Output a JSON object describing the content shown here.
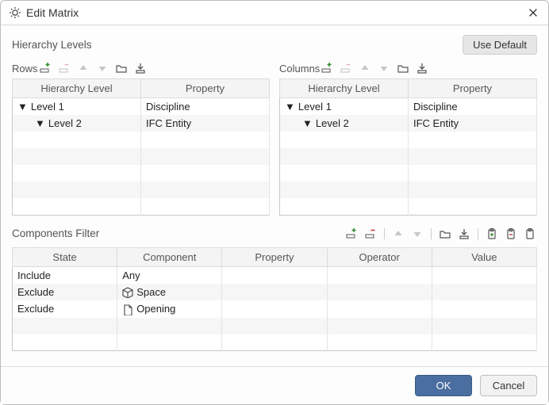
{
  "window": {
    "title": "Edit Matrix"
  },
  "hierarchy": {
    "label": "Hierarchy Levels",
    "defaultButton": "Use Default"
  },
  "rows": {
    "label": "Rows",
    "headers": {
      "level": "Hierarchy Level",
      "property": "Property"
    },
    "items": [
      {
        "level": "Level 1",
        "property": "Discipline",
        "depth": 0
      },
      {
        "level": "Level 2",
        "property": "IFC Entity",
        "depth": 1
      }
    ]
  },
  "columns": {
    "label": "Columns",
    "headers": {
      "level": "Hierarchy Level",
      "property": "Property"
    },
    "items": [
      {
        "level": "Level 1",
        "property": "Discipline",
        "depth": 0
      },
      {
        "level": "Level 2",
        "property": "IFC Entity",
        "depth": 1
      }
    ]
  },
  "filter": {
    "label": "Components Filter",
    "headers": {
      "state": "State",
      "component": "Component",
      "property": "Property",
      "operator": "Operator",
      "value": "Value"
    },
    "items": [
      {
        "state": "Include",
        "component": "Any",
        "icon": null,
        "property": "",
        "operator": "",
        "value": ""
      },
      {
        "state": "Exclude",
        "component": "Space",
        "icon": "cube",
        "property": "",
        "operator": "",
        "value": ""
      },
      {
        "state": "Exclude",
        "component": "Opening",
        "icon": "page",
        "property": "",
        "operator": "",
        "value": ""
      }
    ]
  },
  "buttons": {
    "ok": "OK",
    "cancel": "Cancel"
  },
  "icons": {
    "add": "add-row-icon",
    "remove": "remove-row-icon",
    "up": "move-up-icon",
    "down": "move-down-icon",
    "open": "open-folder-icon",
    "import": "import-icon",
    "copy": "clipboard-copy-icon",
    "cut": "clipboard-cut-icon",
    "paste": "clipboard-paste-icon"
  }
}
